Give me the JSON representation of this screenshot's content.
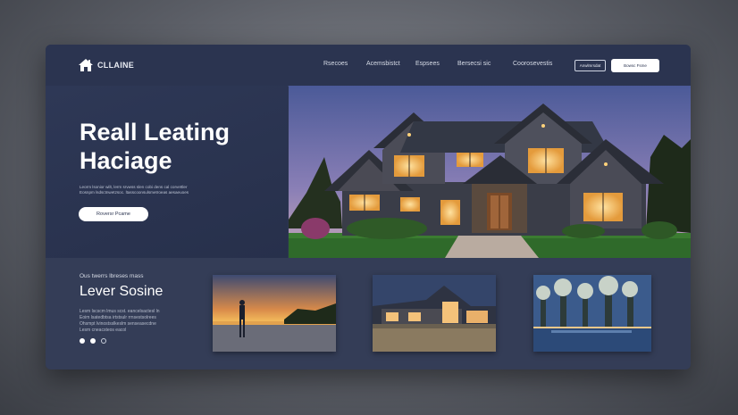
{
  "brand": {
    "name": "CLLAINE",
    "logo_icon": "house-icon"
  },
  "nav": {
    "items": [
      "Rsecoes",
      "Acemsbistct",
      "Espsees",
      "Bersecsi sic",
      "Coorosevestis"
    ],
    "outline_button": "Anwlmrsdat",
    "solid_button": "Bowsc Fsme"
  },
  "hero": {
    "title_line1": "Reall Leating",
    "title_line2": "Haciage",
    "desc_line1": "Leorm lsonior wilt, lerm srvwss slen cobi dens cal corvettler",
    "desc_line2": "Eosnpm lsdsctnwetzsoc. ltasscoonsulsmetroeas aesaeuoes",
    "button": "Roversr Pcame",
    "image_alt": "house-at-dusk"
  },
  "section": {
    "kicker": "Ous twerrs lbreses mass",
    "title": "Lever Sosine",
    "desc_lines": [
      "Lesm lscscm lmus scst.  eancelsactesl ln",
      "Eoim lsatedbtsa irtstsulr  rrnsestsolrees",
      "Ohsmpt lvinostsslkeslm  senseasecdne",
      "Lesm cneacsteos eacol"
    ]
  },
  "thumbnails": [
    {
      "name": "sunset-pier-thumbnail"
    },
    {
      "name": "house-night-thumbnail"
    },
    {
      "name": "lake-trees-thumbnail"
    }
  ],
  "colors": {
    "accent": "#2b3450",
    "panel": "#343d57",
    "text": "#ffffff"
  }
}
